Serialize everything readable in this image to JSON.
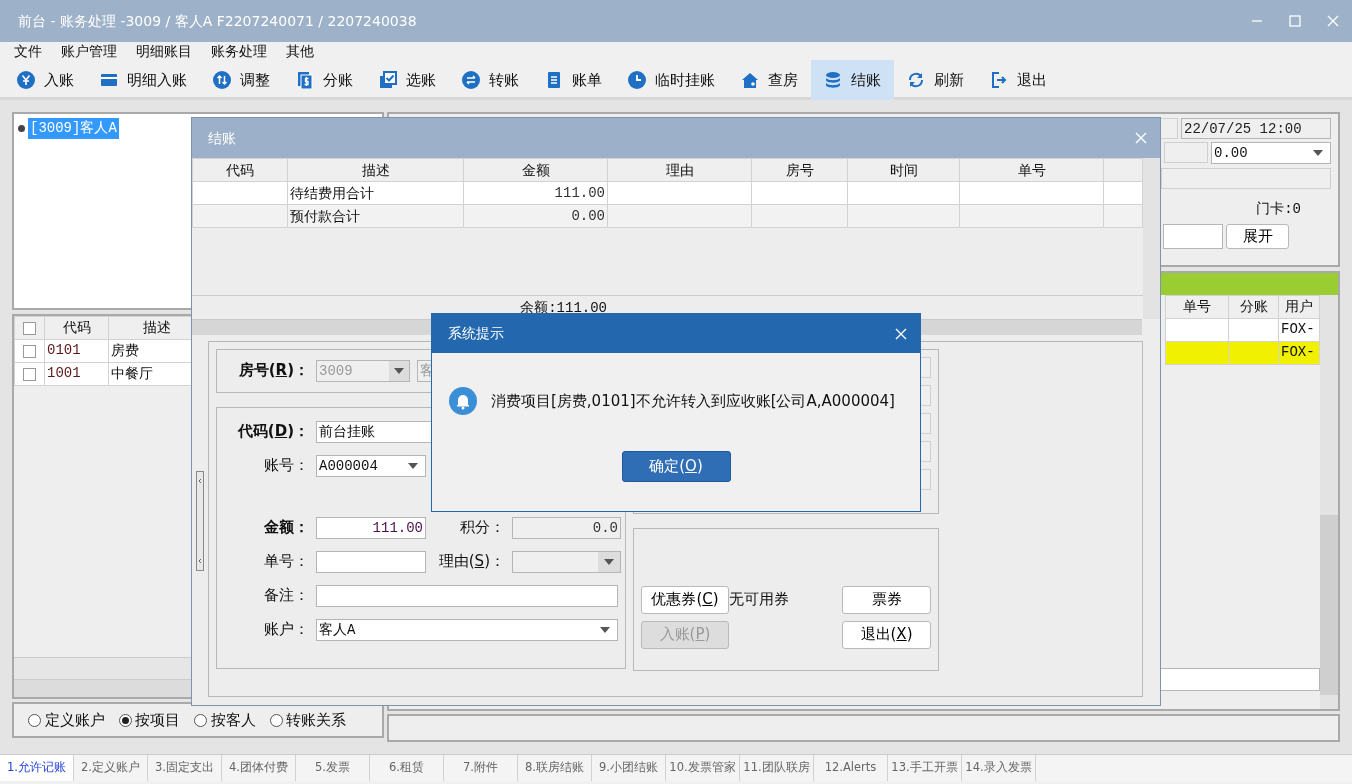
{
  "window": {
    "title": "前台 - 账务处理 -3009 / 客人A F2207240071 / 2207240038"
  },
  "menu": [
    "文件",
    "账户管理",
    "明细账目",
    "账务处理",
    "其他"
  ],
  "toolbar": [
    {
      "label": "入账",
      "selected": false
    },
    {
      "label": "明细入账",
      "selected": false
    },
    {
      "label": "调整",
      "selected": false
    },
    {
      "label": "分账",
      "selected": false
    },
    {
      "label": "选账",
      "selected": false
    },
    {
      "label": "转账",
      "selected": false
    },
    {
      "label": "账单",
      "selected": false
    },
    {
      "label": "临时挂账",
      "selected": false
    },
    {
      "label": "查房",
      "selected": false
    },
    {
      "label": "结账",
      "selected": true
    },
    {
      "label": "刷新",
      "selected": false
    },
    {
      "label": "退出",
      "selected": false
    }
  ],
  "tree": [
    {
      "label": "[3009]客人A",
      "selected": true
    }
  ],
  "items_table": {
    "all_checked": false,
    "columns": [
      "代码",
      "描述"
    ],
    "rows": [
      {
        "checked": false,
        "cells": [
          "0101",
          "房费"
        ]
      },
      {
        "checked": false,
        "cells": [
          "1001",
          "中餐厅"
        ]
      }
    ]
  },
  "view_options": [
    {
      "label": "定义账户",
      "selected": false
    },
    {
      "label": "按项目",
      "selected": true
    },
    {
      "label": "按客人",
      "selected": false
    },
    {
      "label": "转账关系",
      "selected": false
    }
  ],
  "guest_panel": {
    "arrival": "22/07/25 12:00",
    "deposit": "0.00",
    "door_card": "门卡:0",
    "expand_button": "展开"
  },
  "folio_table": {
    "columns": [
      "单号",
      "分账",
      "用户"
    ],
    "rows": [
      {
        "selected": false,
        "cells": [
          "",
          "",
          "FOX-"
        ]
      },
      {
        "selected": true,
        "cells": [
          "",
          "",
          "FOX-"
        ]
      }
    ]
  },
  "settle_dialog": {
    "title": "结账",
    "columns": [
      "代码",
      "描述",
      "金额",
      "理由",
      "房号",
      "时间",
      "单号"
    ],
    "rows": [
      {
        "cells": [
          "",
          "待结费用合计",
          "111.00",
          "",
          "",
          "",
          ""
        ]
      },
      {
        "cells": [
          "",
          "预付款合计",
          "0.00",
          "",
          "",
          "",
          ""
        ]
      }
    ],
    "balance": "余额:111.00",
    "room": {
      "before": "房号(",
      "hotkey": "R",
      "after": ")：",
      "value": "3009",
      "disabled": true,
      "name_fragment": "客"
    },
    "fields": [
      {
        "kind": "text",
        "before": "代码(",
        "hotkey": "D",
        "after": ")：",
        "bold": true,
        "value": "前台挂账"
      },
      {
        "kind": "select",
        "label": "账号：",
        "value": "A000004"
      },
      {
        "kind": "pair",
        "label": "金额：",
        "bold": true,
        "value": "111.00",
        "label2": "积分：",
        "value2": "0.0"
      },
      {
        "kind": "pair-select",
        "label": "单号：",
        "before2": "理由(",
        "hotkey2": "S",
        "after2": ")：",
        "disabled2": true
      },
      {
        "kind": "wide",
        "label": "备注："
      },
      {
        "kind": "wide-select",
        "label": "账户：",
        "value": "客人A"
      }
    ],
    "coupon_button": {
      "before": "优惠券(",
      "hotkey": "C",
      "after": ")"
    },
    "coupon_status": "无可用券",
    "ticket_button": "票券",
    "post_button": {
      "before": "入账(",
      "hotkey": "P",
      "after": ")",
      "disabled": true
    },
    "exit_button": {
      "before": "退出(",
      "hotkey": "X",
      "after": ")"
    }
  },
  "alert": {
    "title": "系统提示",
    "message": "消费项目[房费,0101]不允许转入到应收账[公司A,A000004]",
    "ok_button": {
      "before": "确定(",
      "hotkey": "O",
      "after": ")"
    }
  },
  "bottom_tabs": [
    {
      "label": "1.允许记账",
      "selected": true
    },
    {
      "label": "2.定义账户",
      "selected": false
    },
    {
      "label": "3.固定支出",
      "selected": false
    },
    {
      "label": "4.团体付费",
      "selected": false
    },
    {
      "label": "5.发票",
      "selected": false
    },
    {
      "label": "6.租赁",
      "selected": false
    },
    {
      "label": "7.附件",
      "selected": false
    },
    {
      "label": "8.联房结账",
      "selected": false
    },
    {
      "label": "9.小团结账",
      "selected": false
    },
    {
      "label": "10.发票管家",
      "selected": false
    },
    {
      "label": "11.团队联房",
      "selected": false
    },
    {
      "label": "12.Alerts",
      "selected": false
    },
    {
      "label": "13.手工开票",
      "selected": false
    },
    {
      "label": "14.录入发票",
      "selected": false
    }
  ]
}
